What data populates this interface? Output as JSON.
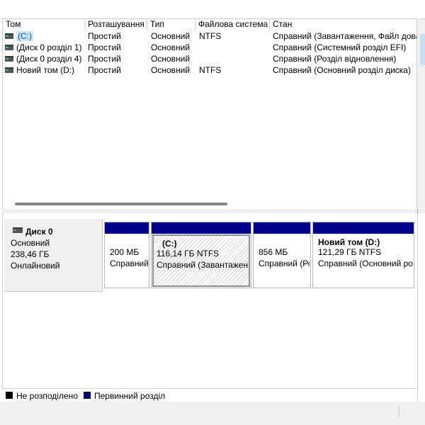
{
  "volume_list": {
    "columns": [
      "Том",
      "Розташування",
      "Тип",
      "Файлова система",
      "Стан"
    ],
    "rows": [
      {
        "volume": "(C:)",
        "layout": "Простий",
        "type": "Основний",
        "fs": "NTFS",
        "status": "Справний (Завантаження, Файл довантаження, ...)",
        "selected": true
      },
      {
        "volume": "(Диск 0 розділ 1)",
        "layout": "Простий",
        "type": "Основний",
        "fs": "",
        "status": "Справний (Системний розділ EFI)"
      },
      {
        "volume": "(Диск 0 розділ 4)",
        "layout": "Простий",
        "type": "Основний",
        "fs": "",
        "status": "Справний (Розділ відновлення)"
      },
      {
        "volume": "Новий том (D:)",
        "layout": "Простий",
        "type": "Основний",
        "fs": "NTFS",
        "status": "Справний (Основний розділ диска)"
      }
    ]
  },
  "disk": {
    "name": "Диск 0",
    "kind": "Основний",
    "size": "238,46 ГБ",
    "state": "Онлайновий",
    "partitions": [
      {
        "title": "",
        "size": "200 МБ",
        "status": "Справний (Системний розділ EFI)",
        "selected": false
      },
      {
        "title": "(C:)",
        "size": "116,14 ГБ NTFS",
        "status": "Справний (Завантаження, Файл довантаження)",
        "selected": true
      },
      {
        "title": "",
        "size": "856 МБ",
        "status": "Справний (Розділ відновлення)",
        "selected": false
      },
      {
        "title": "Новий том  (D:)",
        "size": "121,29 ГБ NTFS",
        "status": "Справний (Основний розділ диска)",
        "selected": false
      }
    ]
  },
  "legend": {
    "unallocated": {
      "label": "Не розподілено",
      "color": "#000000"
    },
    "primary": {
      "label": "Первинний розділ",
      "color": "#00008b"
    }
  }
}
